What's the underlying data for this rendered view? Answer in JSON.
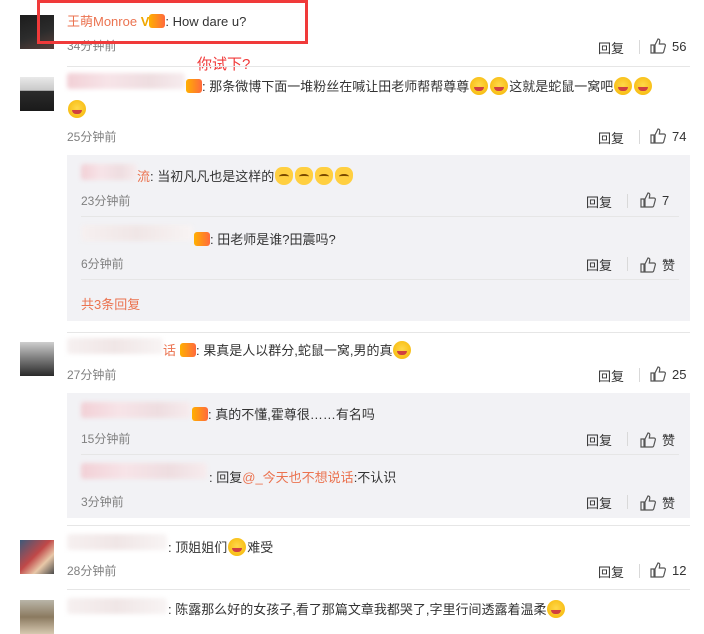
{
  "annotation": {
    "label": "你试下?"
  },
  "actions": {
    "reply": "回复",
    "like_text": "赞"
  },
  "comments": [
    {
      "user": "王萌Monroe",
      "text": "How dare u?",
      "time": "34分钟前",
      "likes": "56"
    },
    {
      "text": "那条微博下面一堆粉丝在喊让田老师帮帮尊尊",
      "text2": "这就是蛇鼠一窝吧",
      "time": "25分钟前",
      "likes": "74",
      "replies": [
        {
          "name_tail": "流",
          "text": "当初凡凡也是这样的",
          "time": "23分钟前",
          "likes": "7"
        },
        {
          "text": "田老师是谁?田震吗?",
          "time": "6分钟前",
          "likes": "赞"
        }
      ],
      "more_replies": "共3条回复"
    },
    {
      "name_tail": "话",
      "text": "果真是人以群分,蛇鼠一窝,男的真",
      "time": "27分钟前",
      "likes": "25",
      "replies": [
        {
          "text": "真的不懂,霍尊很……有名吗",
          "time": "15分钟前",
          "likes": "赞"
        },
        {
          "text_prefix": "回复",
          "mention": "@_今天也不想说话",
          "text": ":不认识",
          "time": "3分钟前",
          "likes": "赞"
        }
      ]
    },
    {
      "text": "顶姐姐们",
      "text2": "难受",
      "time": "28分钟前",
      "likes": "12"
    },
    {
      "text": "陈露那么好的女孩子,看了那篇文章我都哭了,字里行间透露着温柔"
    }
  ]
}
